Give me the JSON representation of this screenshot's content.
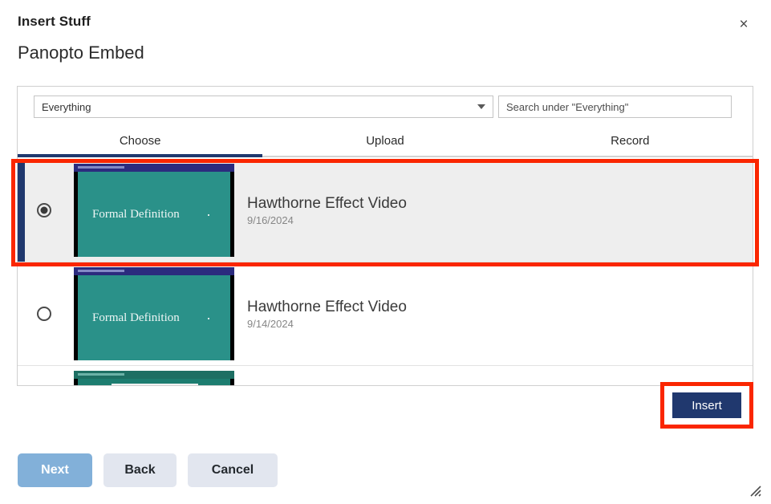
{
  "header": {
    "title": "Insert Stuff",
    "subtitle": "Panopto Embed",
    "close_label": "×",
    "close_icon": "close-icon"
  },
  "filter": {
    "selected_scope": "Everything",
    "scope_options": [
      "Everything"
    ],
    "caret_icon": "chevron-down-icon",
    "search_placeholder": "Search under \"Everything\"",
    "search_value": ""
  },
  "tabs": [
    {
      "label": "Choose",
      "active": true
    },
    {
      "label": "Upload",
      "active": false
    },
    {
      "label": "Record",
      "active": false
    }
  ],
  "results": [
    {
      "title": "Hawthorne Effect Video",
      "date": "9/16/2024",
      "selected": true,
      "thumbnail_text": "Formal Definition",
      "thumbnail_style": "slide"
    },
    {
      "title": "Hawthorne Effect Video",
      "date": "9/14/2024",
      "selected": false,
      "thumbnail_text": "Formal Definition",
      "thumbnail_style": "slide"
    },
    {
      "title": "",
      "date": "",
      "selected": false,
      "thumbnail_text": "",
      "thumbnail_style": "screenshare"
    }
  ],
  "insert_button": {
    "label": "Insert"
  },
  "footer": {
    "next_label": "Next",
    "back_label": "Back",
    "cancel_label": "Cancel"
  },
  "resize_grip": {
    "icon": "resize-handle-icon"
  },
  "colors": {
    "accent_navy": "#20386e",
    "thumbnail_teal": "#2a9189",
    "annotation_red": "#fa2600",
    "next_blue": "#82b0d9",
    "button_gray": "#e2e6ef"
  }
}
